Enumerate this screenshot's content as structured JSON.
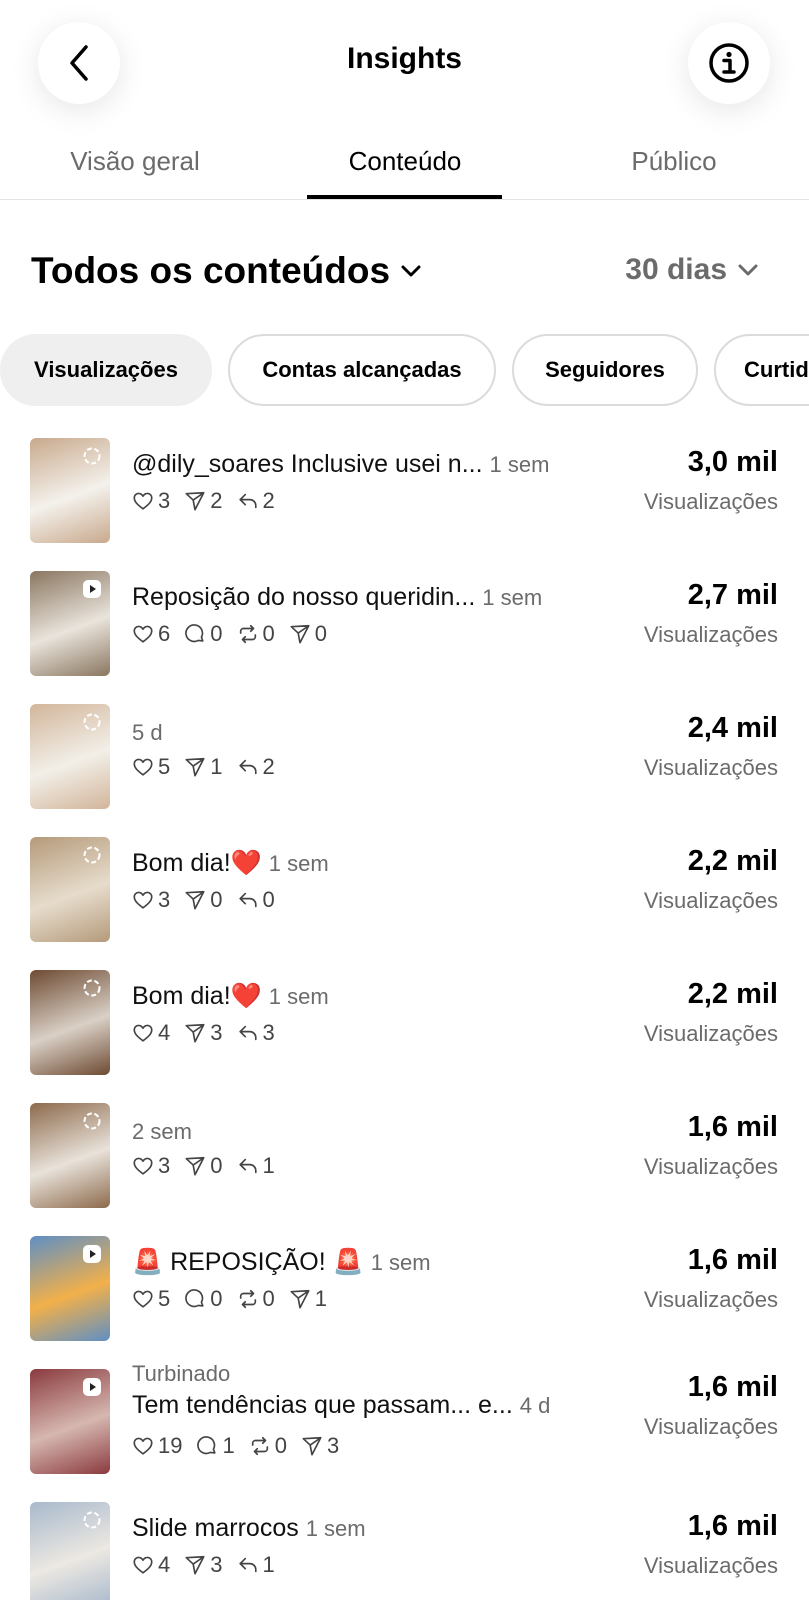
{
  "header": {
    "title": "Insights"
  },
  "tabs": [
    {
      "label": "Visão geral"
    },
    {
      "label": "Conteúdo"
    },
    {
      "label": "Público"
    }
  ],
  "filter": {
    "title": "Todos os conteúdos",
    "period": "30 dias"
  },
  "chips": [
    {
      "label": "Visualizações",
      "selected": true
    },
    {
      "label": "Contas alcançadas"
    },
    {
      "label": "Seguidores"
    },
    {
      "label": "Curtid"
    }
  ],
  "metric_label": "Visualizações",
  "posts": [
    {
      "caption": "@dily_soares  Inclusive usei n...",
      "when": "1 sem",
      "metric": "3,0 mil",
      "likes": "3",
      "shares": "2",
      "replies": "2"
    },
    {
      "caption": "Reposição do nosso queridin...",
      "when": "1 sem",
      "metric": "2,7 mil",
      "likes": "6",
      "comments": "0",
      "reposts": "0",
      "shares": "0"
    },
    {
      "caption": "",
      "when": "5 d",
      "metric": "2,4 mil",
      "likes": "5",
      "shares": "1",
      "replies": "2"
    },
    {
      "caption": "Bom dia!❤️",
      "when": "1 sem",
      "metric": "2,2 mil",
      "likes": "3",
      "shares": "0",
      "replies": "0"
    },
    {
      "caption": "Bom dia!❤️",
      "when": "1 sem",
      "metric": "2,2 mil",
      "likes": "4",
      "shares": "3",
      "replies": "3"
    },
    {
      "caption": "",
      "when": "2 sem",
      "metric": "1,6 mil",
      "likes": "3",
      "shares": "0",
      "replies": "1"
    },
    {
      "caption": "🚨 REPOSIÇÃO! 🚨",
      "when": "1 sem",
      "metric": "1,6 mil",
      "likes": "5",
      "comments": "0",
      "reposts": "0",
      "shares": "1"
    },
    {
      "boosted": "Turbinado",
      "caption": "Tem tendências que passam... e...",
      "when": "4 d",
      "metric": "1,6 mil",
      "likes": "19",
      "comments": "1",
      "reposts": "0",
      "shares": "3"
    },
    {
      "caption": "Slide marrocos",
      "when": "1 sem",
      "metric": "1,6 mil",
      "likes": "4",
      "shares": "3",
      "replies": "1"
    }
  ]
}
